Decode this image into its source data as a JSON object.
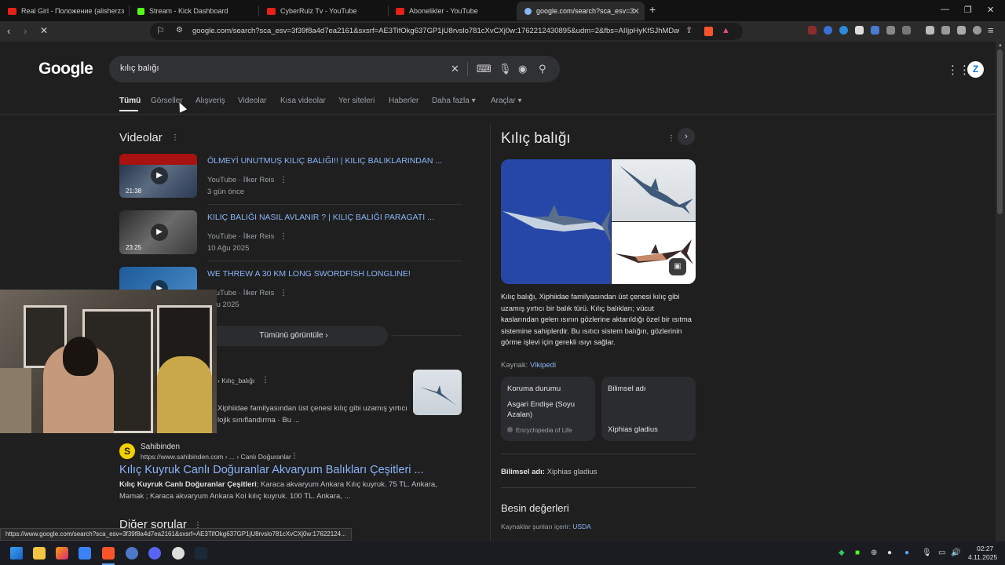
{
  "browser": {
    "tabs": [
      {
        "title": "Real Girl - Положение (alisherzз",
        "color": "#e62117"
      },
      {
        "title": "Stream - Kick Dashboard",
        "color": "#53fc18"
      },
      {
        "title": "CyberRulz Tv - YouTube",
        "color": "#e62117"
      },
      {
        "title": "Abonelikler - YouTube",
        "color": "#e62117"
      },
      {
        "title": "google.com/search?sca_esv=3f3",
        "color": "#8ab4f8"
      }
    ],
    "new_tab": "+",
    "url": "google.com/search?sca_esv=3f39f8a4d7ea2161&sxsrf=AE3TifOkg637GP1jU8rvslo781cXvCXj0w:1762212430895&udm=2&fbs=AIIjpHyKfSJhMDaO...",
    "window_controls": [
      "—",
      "❐",
      "✕"
    ]
  },
  "google": {
    "logo": "Google",
    "query": "kılıç balığı",
    "avatar_letter": "Z",
    "tabs": [
      "Tümü",
      "Görseller",
      "Alışveriş",
      "Videolar",
      "Kısa videolar",
      "Yer siteleri",
      "Haberler",
      "Daha fazla ▾",
      "Araçlar ▾"
    ]
  },
  "videos": {
    "title": "Videolar",
    "items": [
      {
        "title": "ÖLMEYİ UNUTMUŞ KILIÇ BALIĞI!! | KILIÇ BALIKLARINDAN ...",
        "source": "YouTube · İlker Reis",
        "date": "3 gün önce",
        "duration": "21:38"
      },
      {
        "title": "KILIÇ BALIĞI NASIL AVLANIR ? | KILIÇ BALIĞI PARAGATI ...",
        "source": "YouTube · İlker Reis",
        "date": "10 Ağu 2025",
        "duration": "23:25"
      },
      {
        "title": "WE THREW A 30 KM LONG SWORDFISH LONGLINE!",
        "source": "YouTube · İlker Reis",
        "date": "Ağu 2025",
        "duration": ""
      }
    ],
    "view_all": "Tümünü görüntüle ›"
  },
  "wiki_result": {
    "breadcrumb": "› Kılıç_balığı",
    "snippet1": "Xiphiidae familyasından üst çenesi kılıç gibi uzamış yırtıcı",
    "snippet2": "lojik sınıflandırma · Bu ..."
  },
  "sahibinden": {
    "name": "Sahibinden",
    "url": "https://www.sahibinden.com › ... › Canlı Doğuranlar",
    "title": "Kılıç Kuyruk Canlı Doğuranlar Akvaryum Balıkları Çeşitleri ...",
    "snippet_bold": "Kılıç Kuyruk Canlı Doğuranlar Çeşitleri",
    "snippet1_rest": "; Karaca akvaryum Ankara Kılıç kuyruk. 75 TL. Ankara,",
    "snippet2": "Mamak ; Karaca akvaryum Ankara Koi kılıç kuyruk. 100 TL. Ankara, ..."
  },
  "other_questions": "Diğer sorular",
  "knowledge_panel": {
    "title": "Kılıç balığı",
    "description": [
      "Kılıç balığı, Xiphiidae familyasından üst çenesi kılıç gibi",
      "uzamış yırtıcı bir balık türü. Kılıç balıkları; vücut",
      "kaslarından gelen ısının gözlerine aktarıldığı özel bir ısıtma",
      "sistemine sahiplerdir. Bu ısıtıcı sistem balığın, gözlerinin",
      "görme işlevi için gerekli ısıyı sağlar."
    ],
    "source_label": "Kaynak:",
    "source_link": "Vikipedi",
    "card1": {
      "title": "Koruma durumu",
      "value1": "Asgari Endişe (Soyu",
      "value2": "Azalan)",
      "source": "Encyclopedia of Life"
    },
    "card2": {
      "title": "Bilimsel adı",
      "value": "Xiphias gladius"
    },
    "sci_label": "Bilimsel adı:",
    "sci_value": "Xiphias gladius",
    "nutrition_title": "Besin değerleri",
    "nutrition_src_label": "Kaynaklar şunları içerir:",
    "nutrition_src_link": "USDA"
  },
  "status_url": "https://www.google.com/search?sca_esv=3f39f8a4d7ea2161&sxsrf=AE3TifOkg637GP1jU8rvslo781cXvCXj0w:17622124...",
  "taskbar": {
    "time": "02:27",
    "date": "4.11.2025"
  }
}
